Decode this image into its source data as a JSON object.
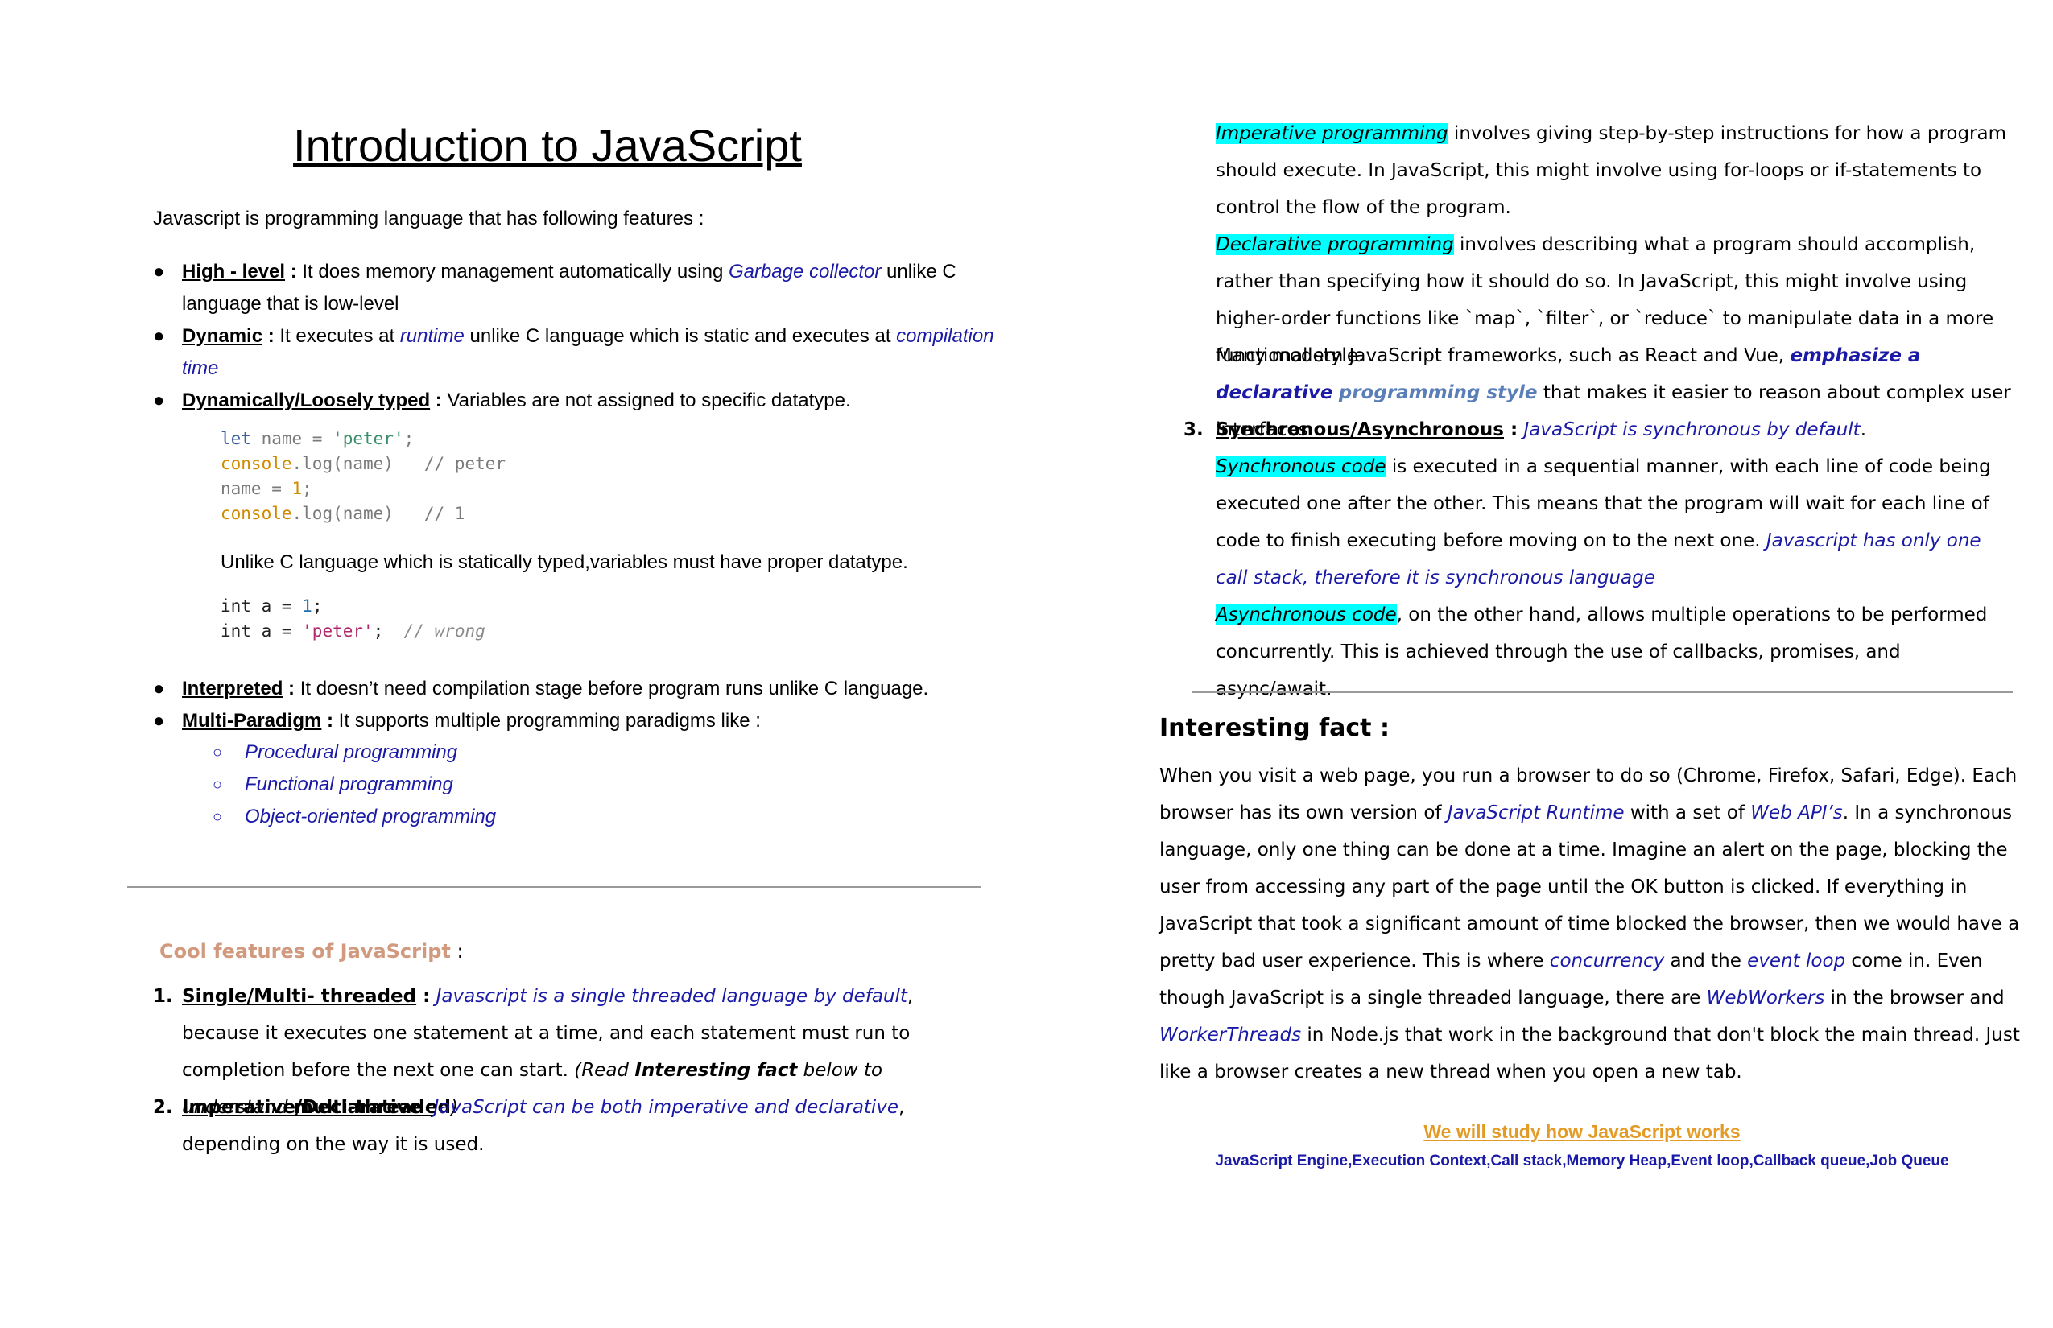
{
  "title": "Introduction to JavaScript",
  "intro": "Javascript is programming language that has following features :",
  "features": [
    {
      "name": "High - level",
      "sep": " :",
      "pre": " It does memory management automatically using ",
      "em": "Garbage collector",
      "post": " unlike C language that is low-level"
    },
    {
      "name": "Dynamic",
      "sep": " :",
      "pre": " It executes at ",
      "em": "runtime",
      "mid": "  unlike C language which is static and executes at ",
      "em2": "compilation time"
    },
    {
      "name": "Dynamically/Loosely typed",
      "sep": " :",
      "pre": " Variables are not assigned to specific datatype."
    }
  ],
  "code1": [
    {
      "kw": "let",
      "rest": " name = ",
      "str": "'peter'",
      "end": ";"
    },
    {
      "cons": "console",
      "rest": ".log(name)   // peter"
    },
    {
      "rest": "name = ",
      "num": "1",
      "end": ";"
    },
    {
      "cons": "console",
      "rest": ".log(name)   // 1"
    }
  ],
  "static_note": "Unlike C language which is statically typed,variables must have proper datatype.",
  "code2": [
    {
      "a": "int a = ",
      "num": "1",
      "end": ";"
    },
    {
      "a": "int a = ",
      "str": "'peter'",
      "end": ";  ",
      "cmt": "// wrong"
    }
  ],
  "features2": [
    {
      "name": "Interpreted",
      "sep": " :",
      "pre": " It doesn’t need compilation stage before program runs unlike C language."
    },
    {
      "name": "Multi-Paradigm",
      "sep": " :",
      "pre": " It supports multiple programming paradigms like :"
    }
  ],
  "paradigms": [
    "Procedural programming",
    "Functional programming",
    "Object-oriented programming"
  ],
  "cool_title": "Cool features of JavaScript",
  "cool_colon": " :",
  "cool": {
    "item1": {
      "n": "1.",
      "name": "Single/Multi- threaded",
      "sep": " :",
      "em": "Javascript is a single threaded language by default",
      "post": ",  because it executes one statement at a time, and each statement must run to completion before the next one can start. ",
      "read1": "(Read ",
      "read_b": "Interesting fact",
      "read2": " below to understand ",
      "read_b2": "multi-threaded",
      "read3": ")"
    },
    "item2": {
      "n": "2.",
      "name": "Imperative/Declarative",
      "sep": " :",
      "em": "JavaScript can be both imperative and declarative",
      "post": ", depending on the way it is used."
    }
  },
  "right": {
    "imperative_hl": "Imperative programming",
    "imperative_text": " involves giving step-by-step instructions for how a program should execute. In JavaScript, this might involve using for-loops or if-statements to control the flow of the program.",
    "declarative_hl": "Declarative programming",
    "declarative_text": " involves describing what a program should accomplish, rather than specifying how it should do so. In JavaScript, this might involve using higher-order functions like `map`, `filter`, or `reduce` to manipulate data in a more functional style.",
    "frameworks_pre": "Many modern JavaScript frameworks, such as React and Vue, ",
    "frameworks_b1": "emphasize a declarative",
    "frameworks_b2": "programming style",
    "frameworks_post": " that makes it easier to reason about complex user interfaces.",
    "item3_n": "3.",
    "item3_name": "Synchronous/Asynchronous",
    "item3_sep": " :",
    "item3_em": "JavaScript is synchronous by default",
    "item3_dot": ".",
    "sync_hl": "Synchronous code",
    "sync_text": " is executed in a sequential manner, with each line of code being executed one after the other. This means that the program will wait for each line of code to finish executing before moving on to the next one. ",
    "sync_em": "Javascript has only one call stack, therefore it is synchronous language",
    "async_hl": "Asynchronous code",
    "async_text": ", on the other hand, allows multiple operations to be performed concurrently. This is achieved through the use of callbacks, promises, and async/await.",
    "fact_title": "Interesting fact :",
    "fact": [
      {
        "t": "When you visit a web page, you run a browser to do so (Chrome, Firefox, Safari, Edge). Each browser has its own version of "
      },
      {
        "e": "JavaScript Runtime"
      },
      {
        "t": " with a set of "
      },
      {
        "e": "Web API’s"
      },
      {
        "t": ". In a synchronous language, only one thing can be done at a time. Imagine an alert on the page, blocking the user from accessing any part of the page until the OK button is clicked. If everything in JavaScript that took a significant amount of time blocked the browser, then we would have a pretty bad user experience. This is where "
      },
      {
        "e": "concurrency"
      },
      {
        "t": " and the "
      },
      {
        "e": "event loop"
      },
      {
        "t": " come in. Even though JavaScript is a single threaded language, there are "
      },
      {
        "e": "WebWorkers"
      },
      {
        "t": " in the browser and "
      },
      {
        "e": "WorkerThreads"
      },
      {
        "t": " in Node.js that work in the background that don't block the main thread. Just like a browser creates a new thread when you open a new tab."
      }
    ],
    "study": "We will study how JavaScript works",
    "topics": "JavaScript Engine,Execution Context,Call stack,Memory Heap,Event loop,Callback queue,Job Queue"
  },
  "colors": {
    "link_blue": "#1a1aa6",
    "highlight": "#00ffff",
    "cool_title": "#d19a7e",
    "study": "#e39b26"
  }
}
